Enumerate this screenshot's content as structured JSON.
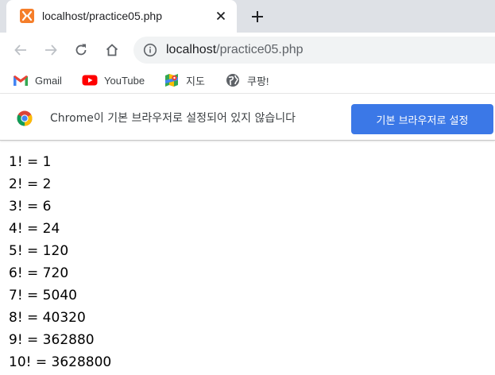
{
  "browser": {
    "tab": {
      "title": "localhost/practice05.php"
    },
    "address": {
      "host": "localhost",
      "path": "/practice05.php"
    },
    "bookmarks": [
      {
        "label": "Gmail",
        "icon": "gmail-icon"
      },
      {
        "label": "YouTube",
        "icon": "youtube-icon"
      },
      {
        "label": "지도",
        "icon": "maps-icon"
      },
      {
        "label": "쿠팡!",
        "icon": "globe-icon"
      }
    ],
    "infobar": {
      "message": "Chrome이 기본 브라우저로 설정되어 있지 않습니다",
      "button_label": "기본 브라우저로 설정"
    }
  },
  "page": {
    "lines": [
      "1! = 1",
      "2! = 2",
      "3! = 6",
      "4! = 24",
      "5! = 120",
      "6! = 720",
      "7! = 5040",
      "8! = 40320",
      "9! = 362880",
      "10! = 3628800"
    ]
  },
  "colors": {
    "tabstrip": "#dee1e6",
    "accent_button": "#3b78e7",
    "favicon": "#f57e2a"
  }
}
